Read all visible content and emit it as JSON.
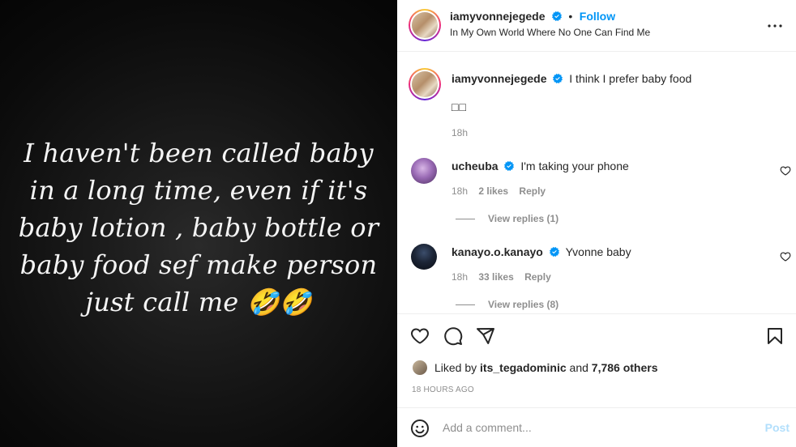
{
  "media": {
    "story_text": "I haven't been called baby in a long time, even if it's baby lotion , baby bottle or baby food sef make person just call me 🤣🤣"
  },
  "header": {
    "username": "iamyvonnejegede",
    "dot": "•",
    "follow_label": "Follow",
    "location": "In My Own World Where No One Can Find Me",
    "more_icon": "more-horizontal-icon"
  },
  "caption": {
    "username": "iamyvonnejegede",
    "text": "I think I prefer baby food",
    "emoji_line": "□□",
    "time": "18h"
  },
  "comments": [
    {
      "username": "ucheuba",
      "text": "I'm taking your phone",
      "time": "18h",
      "likes": "2 likes",
      "reply_label": "Reply",
      "view_replies": "View replies (1)"
    },
    {
      "username": "kanayo.o.kanayo",
      "text": "Yvonne baby",
      "time": "18h",
      "likes": "33 likes",
      "reply_label": "Reply",
      "view_replies": "View replies (8)"
    }
  ],
  "actions": {
    "liked_by_prefix": "Liked by",
    "liked_by_user": "its_tegadominic",
    "liked_by_and": "and",
    "liked_by_others": "7,786 others",
    "timestamp": "18 hours ago"
  },
  "add_comment": {
    "placeholder": "Add a comment...",
    "post_label": "Post"
  },
  "colors": {
    "accent": "#0095f6",
    "verified": "#0095f6",
    "secondary_text": "#8e8e8e",
    "post_disabled": "#b2dffc"
  }
}
